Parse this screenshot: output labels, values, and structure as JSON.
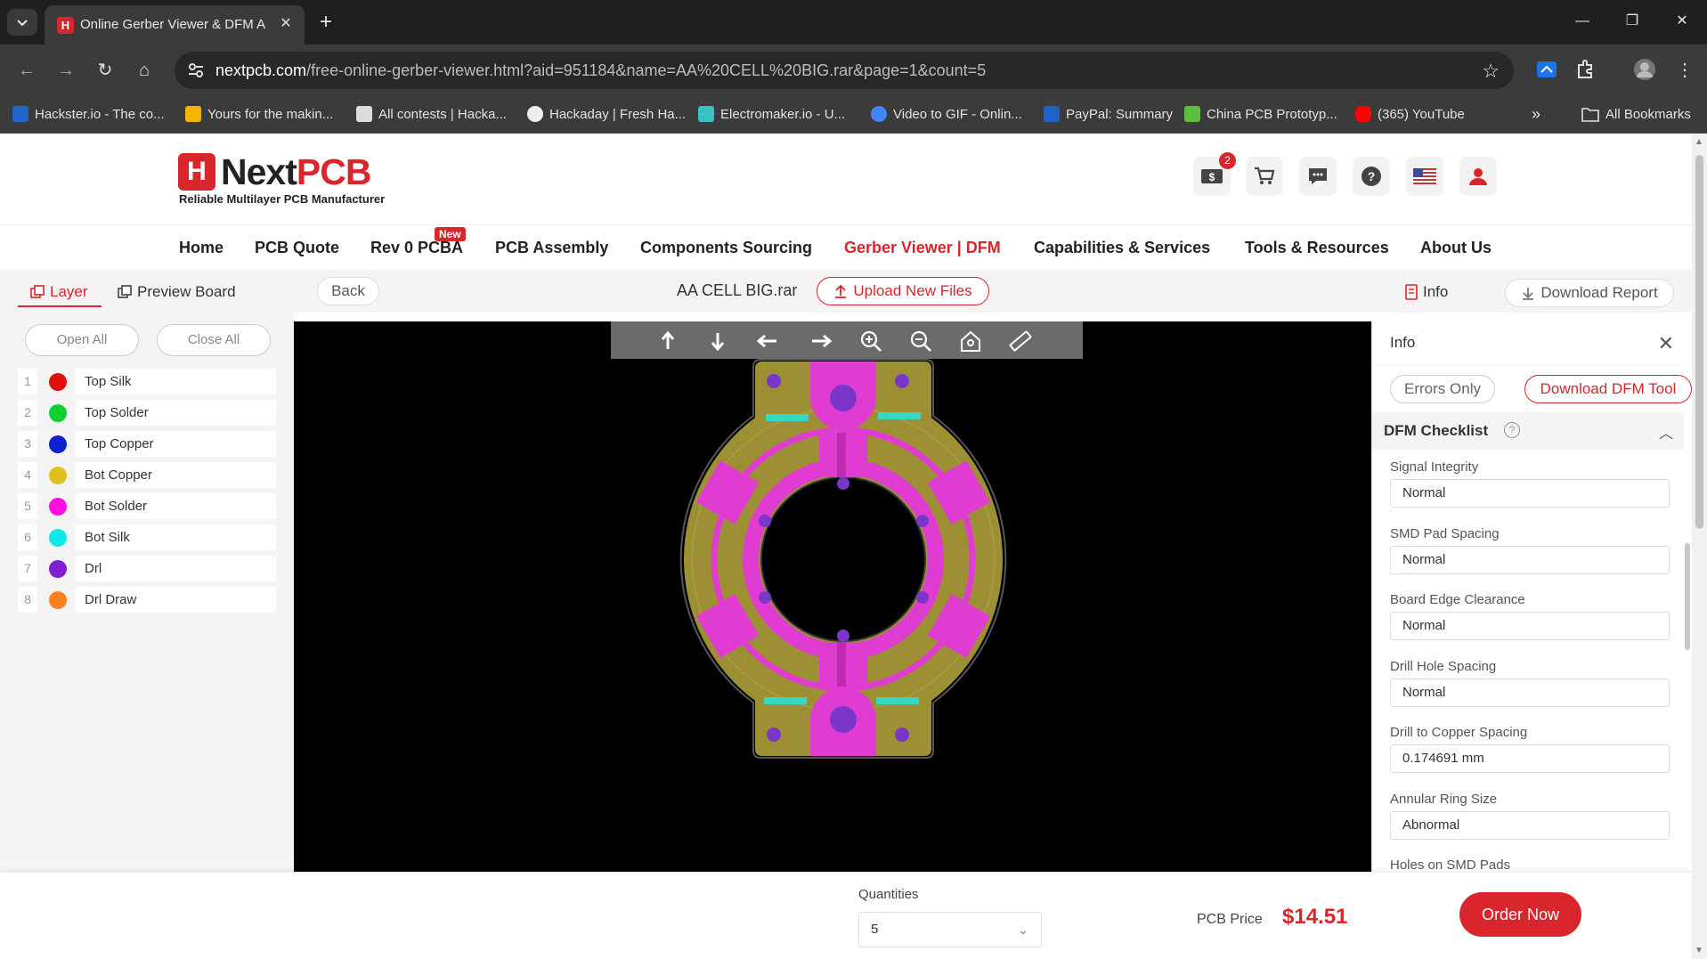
{
  "browser": {
    "tab_title": "Online Gerber Viewer & DFM A",
    "url_host": "nextpcb.com",
    "url_path": "/free-online-gerber-viewer.html?aid=951184&name=AA%20CELL%20BIG.rar&page=1&count=5",
    "bookmarks": [
      {
        "label": "Hackster.io - The co...",
        "icon": "hackster-icon",
        "color": "#2266cc"
      },
      {
        "label": "Yours for the makin...",
        "icon": "instructables-icon",
        "color": "#f4b400"
      },
      {
        "label": "All contests | Hacka...",
        "icon": "hackaday-icon",
        "color": "#ffffff"
      },
      {
        "label": "Hackaday | Fresh Ha...",
        "icon": "hackaday-skull-icon",
        "color": "#ffffff"
      },
      {
        "label": "Electromaker.io - U...",
        "icon": "electromaker-icon",
        "color": "#3ac1c1"
      },
      {
        "label": "Video to GIF - Onlin...",
        "icon": "ezgif-icon",
        "color": "#4285f4"
      },
      {
        "label": "PayPal: Summary",
        "icon": "paypal-icon",
        "color": "#1f63c6"
      },
      {
        "label": "China PCB Prototyp...",
        "icon": "jlcpcb-icon",
        "color": "#5fbf3a"
      },
      {
        "label": "(365) YouTube",
        "icon": "youtube-icon",
        "color": "#ff0000"
      }
    ],
    "all_bookmarks": "All Bookmarks"
  },
  "header": {
    "logo_main": "NextPCB",
    "logo_sub": "Reliable Multilayer PCB Manufacturer",
    "coupon_badge": "2"
  },
  "nav": {
    "items": [
      "Home",
      "PCB Quote",
      "Rev 0 PCBA",
      "PCB Assembly",
      "Components Sourcing",
      "Gerber Viewer | DFM",
      "Capabilities & Services",
      "Tools & Resources",
      "About Us"
    ],
    "new_tag": "New"
  },
  "subbar": {
    "layer_tab": "Layer",
    "preview_tab": "Preview Board",
    "back": "Back",
    "filename": "AA CELL BIG.rar",
    "upload": "Upload New Files",
    "info": "Info",
    "download_report": "Download Report"
  },
  "layers": {
    "open_all": "Open All",
    "close_all": "Close All",
    "items": [
      {
        "num": "1",
        "name": "Top Silk",
        "color": "#e01010"
      },
      {
        "num": "2",
        "name": "Top Solder",
        "color": "#10d030"
      },
      {
        "num": "3",
        "name": "Top Copper",
        "color": "#1020d0"
      },
      {
        "num": "4",
        "name": "Bot Copper",
        "color": "#e0c020"
      },
      {
        "num": "5",
        "name": "Bot Solder",
        "color": "#ff10e0"
      },
      {
        "num": "6",
        "name": "Bot Silk",
        "color": "#10e8e8"
      },
      {
        "num": "7",
        "name": "Drl",
        "color": "#8020d0"
      },
      {
        "num": "8",
        "name": "Drl Draw",
        "color": "#ff8020"
      }
    ]
  },
  "info_panel": {
    "title": "Info",
    "errors_only": "Errors Only",
    "download_dfm": "Download DFM Tool",
    "checklist_title": "DFM Checklist",
    "checks": [
      {
        "label": "Signal Integrity",
        "value": "Normal"
      },
      {
        "label": "SMD Pad Spacing",
        "value": "Normal"
      },
      {
        "label": "Board Edge Clearance",
        "value": "Normal"
      },
      {
        "label": "Drill Hole Spacing",
        "value": "Normal"
      },
      {
        "label": "Drill to Copper Spacing",
        "value": "0.174691 mm"
      },
      {
        "label": "Annular Ring Size",
        "value": "Abnormal"
      },
      {
        "label": "Holes on SMD Pads",
        "value": ""
      }
    ]
  },
  "bottom": {
    "quantities_label": "Quantities",
    "quantity_value": "5",
    "price_label": "PCB Price",
    "price_value": "$14.51",
    "order_now": "Order Now"
  },
  "colors": {
    "brand_red": "#d8262c",
    "board_gold": "#9d9034",
    "bot_solder": "#e13cd2",
    "silk_cyan": "#35d8c0",
    "drill_purple": "#7a36c8"
  }
}
